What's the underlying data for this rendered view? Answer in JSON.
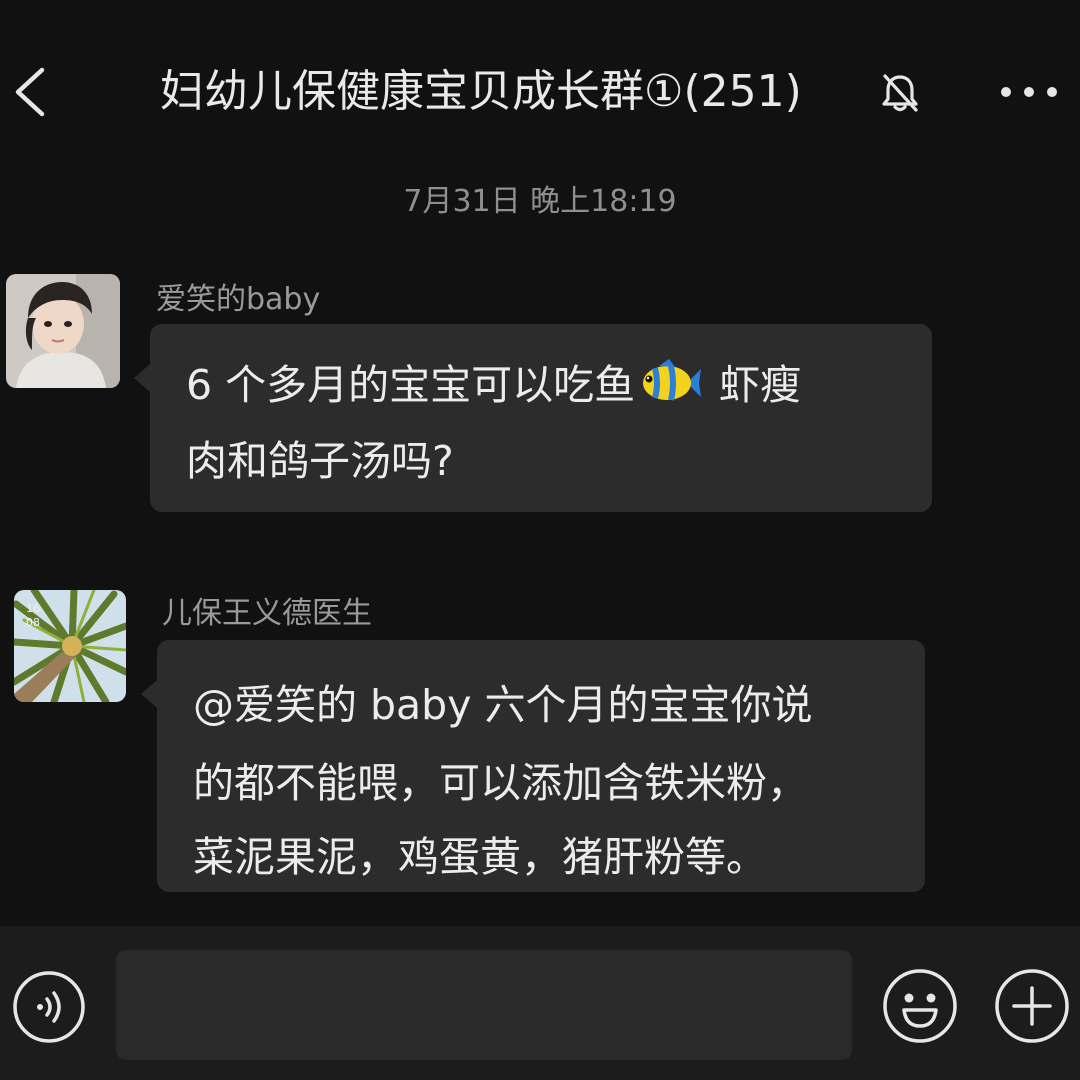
{
  "header": {
    "title": "妇幼儿保健康宝贝成长群①(251)",
    "back_icon": "chevron-left-icon",
    "mute_icon": "bell-off-icon",
    "more_icon": "more-dots-icon"
  },
  "timestamp": "7月31日 晚上18:19",
  "messages": [
    {
      "sender": "爱笑的baby",
      "avatar_icon": "girl-photo-avatar",
      "lines": [
        "6 个多月的宝宝可以吃鱼",
        "虾瘦",
        "肉和鸽子汤吗?"
      ],
      "inline_emoji": "tropical-fish-emoji"
    },
    {
      "sender": "儿保王义德医生",
      "avatar_icon": "palm-tree-photo-avatar",
      "lines": [
        "@爱笑的 baby  六个月的宝宝你说",
        "的都不能喂，可以添加含铁米粉，",
        "菜泥果泥，鸡蛋黄，猪肝粉等。"
      ]
    }
  ],
  "input_bar": {
    "voice_icon": "voice-icon",
    "input_value": "",
    "emoji_icon": "smiley-icon",
    "plus_icon": "plus-icon"
  },
  "colors": {
    "background": "#111111",
    "bubble": "#2c2c2c",
    "input_bar": "#1c1c1c",
    "muted_text": "#8f8f8f"
  }
}
